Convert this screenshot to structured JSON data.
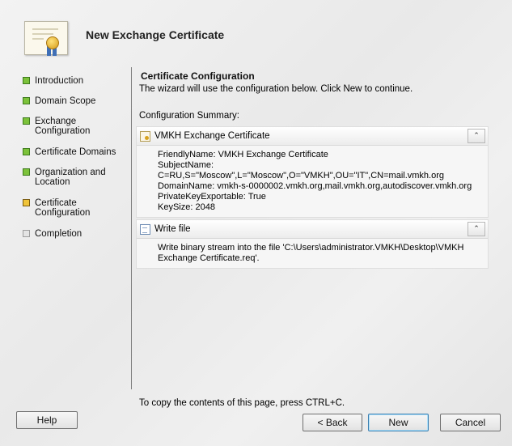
{
  "window": {
    "title": "New Exchange Certificate"
  },
  "icons": {
    "header": "certificate-icon",
    "panel1": "certificate-icon",
    "panel2": "file-icon",
    "collapse": "double-chevron-up-icon"
  },
  "nav": {
    "items": [
      {
        "label": "Introduction",
        "status": "complete"
      },
      {
        "label": "Domain Scope",
        "status": "complete"
      },
      {
        "label": "Exchange\nConfiguration",
        "status": "complete"
      },
      {
        "label": "Certificate Domains",
        "status": "complete"
      },
      {
        "label": "Organization and\nLocation",
        "status": "complete"
      },
      {
        "label": "Certificate\nConfiguration",
        "status": "current"
      },
      {
        "label": "Completion",
        "status": "pending"
      }
    ]
  },
  "main": {
    "section_title": "Certificate Configuration",
    "description": "The wizard will use the configuration below.  Click New to continue.",
    "summary_label": "Configuration Summary:",
    "panels": [
      {
        "title": "VMKH Exchange Certificate",
        "collapse_glyph": "⌃",
        "body": "FriendlyName: VMKH Exchange Certificate\nSubjectName:\nC=RU,S=\"Moscow\",L=\"Moscow\",O=\"VMKH\",OU=\"IT\",CN=mail.vmkh.org\nDomainName: vmkh-s-0000002.vmkh.org,mail.vmkh.org,autodiscover.vmkh.org\nPrivateKeyExportable: True\nKeySize: 2048"
      },
      {
        "title": "Write file",
        "collapse_glyph": "⌃",
        "body": "Write binary stream into the file 'C:\\Users\\administrator.VMKH\\Desktop\\VMKH\nExchange Certificate.req'."
      }
    ],
    "footer_note": "To copy the contents of this page, press CTRL+C."
  },
  "buttons": {
    "help": "Help",
    "back": "< Back",
    "next": "New",
    "cancel": "Cancel"
  }
}
